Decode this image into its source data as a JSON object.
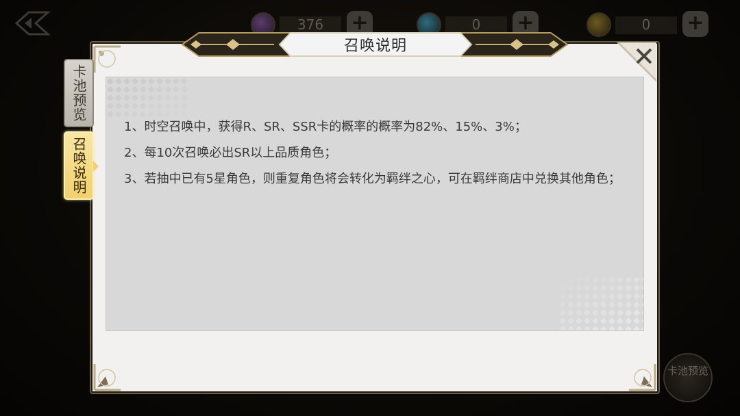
{
  "topbar": {
    "currencies": [
      {
        "icon": "purple-gem-icon",
        "value": "376"
      },
      {
        "icon": "blue-orb-icon",
        "value": "0"
      },
      {
        "icon": "gold-coin-icon",
        "value": "0"
      }
    ],
    "add_symbol": "+"
  },
  "side_button": {
    "label": "卡池预览"
  },
  "modal": {
    "title": "召唤说明",
    "close_symbol": "×"
  },
  "tabs": [
    {
      "label": "卡池预览",
      "active": false
    },
    {
      "label": "召唤说明",
      "active": true
    }
  ],
  "rules": [
    "1、时空召唤中，获得R、SR、SSR卡的概率的概率为82%、15%、3%；",
    "2、每10次召唤必出SR以上品质角色；",
    "3、若抽中已有5星角色，则重复角色将会转化为羁绊之心，可在羁绊商店中兑换其他角色；"
  ],
  "colors": {
    "accent_gold": "#f2d16d",
    "frame": "#6d5f43",
    "panel": "#f3f1ef",
    "content_bg": "#d8d8d8"
  }
}
